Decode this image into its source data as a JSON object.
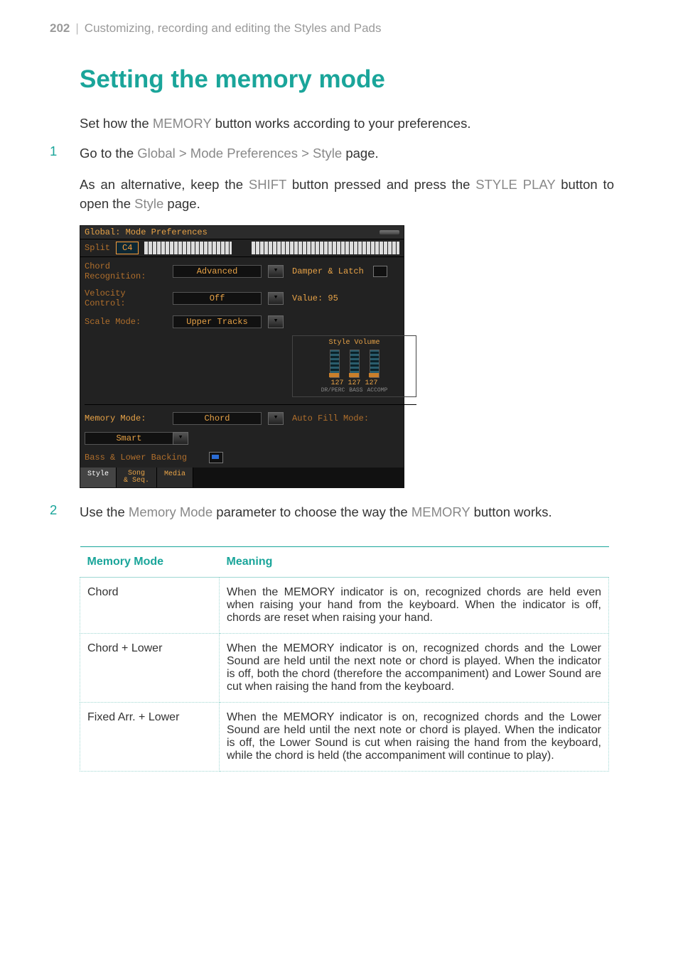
{
  "header": {
    "page_number": "202",
    "separator": "|",
    "chapter": "Customizing, recording and editing the Styles and Pads"
  },
  "title": "Setting the memory mode",
  "intro": {
    "pre": "Set how the ",
    "key": "MEMORY",
    "post": " button works according to your preferences."
  },
  "step1": {
    "num": "1",
    "a": "Go to the ",
    "b": "Global > Mode Preferences > Style",
    "c": " page.",
    "alt_a": "As an alternative, keep the ",
    "alt_b": "SHIFT",
    "alt_c": " button pressed and press the ",
    "alt_d": "STYLE PLAY",
    "alt_e": " button to open the ",
    "alt_f": "Style",
    "alt_g": " page."
  },
  "lcd": {
    "title": "Global: Mode Preferences",
    "split_label": "Split",
    "split_value": "C4",
    "rows": {
      "chord_recognition": {
        "label": "Chord Recognition:",
        "value": "Advanced"
      },
      "velocity_control": {
        "label": "Velocity Control:",
        "value": "Off"
      },
      "scale_mode": {
        "label": "Scale Mode:",
        "value": "Upper Tracks"
      },
      "memory_mode": {
        "label": "Memory Mode:",
        "value": "Chord"
      },
      "auto_fill": {
        "label": "Auto Fill Mode:",
        "value": "Smart"
      },
      "bass_lower": {
        "label": "Bass & Lower Backing"
      }
    },
    "damper_label": "Damper & Latch",
    "value_label": "Value: 95",
    "style_volume": {
      "title": "Style Volume",
      "values": [
        "127",
        "127",
        "127"
      ],
      "labels": [
        "DR/PERC",
        "BASS",
        "ACCOMP"
      ]
    },
    "tabs": [
      "Style",
      "Song\n& Seq.",
      "Media"
    ]
  },
  "step2": {
    "num": "2",
    "a": "Use the ",
    "b": "Memory Mode",
    "c": " parameter to choose the way the ",
    "d": "MEMORY",
    "e": " button works."
  },
  "table": {
    "headers": [
      "Memory Mode",
      "Meaning"
    ],
    "rows": [
      {
        "mode": "Chord",
        "meaning": "When the MEMORY indicator is on, recognized chords are held even when raising your hand from the keyboard. When the indicator is off, chords are reset when raising your hand."
      },
      {
        "mode": "Chord + Lower",
        "meaning": "When the MEMORY indicator is on, recognized chords and the Lower Sound are held until the next note or chord is played. When the indicator is off, both the chord (therefore the accompaniment) and Lower Sound are cut when raising the hand from the keyboard."
      },
      {
        "mode": "Fixed Arr. + Lower",
        "meaning": "When the MEMORY indicator is on, recognized chords and the Lower Sound are held until the next note or chord is played. When the indicator is off, the Lower Sound is cut when raising the hand from the keyboard, while the chord is held (the accompaniment will continue to play)."
      }
    ]
  }
}
